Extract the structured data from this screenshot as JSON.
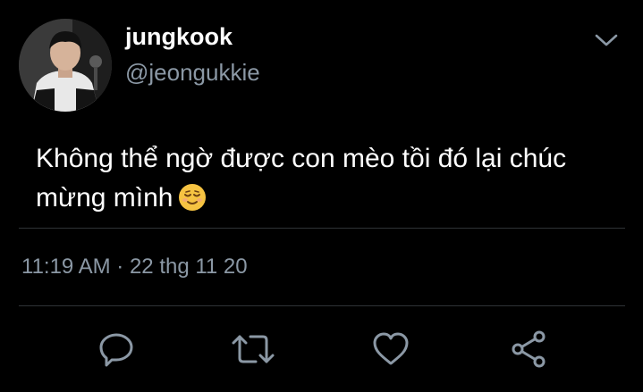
{
  "author": {
    "display_name": "jungkook",
    "handle": "@jeongukkie"
  },
  "tweet": {
    "line1": "Không thể ngờ được con mèo tồi đó lại chúc",
    "line2": "mừng mình",
    "emoji": "relieved-face-emoji",
    "timestamp": "11:19 AM · 22 thg 11 20"
  },
  "icons": {
    "menu": "chevron-down-icon",
    "reply": "reply-icon",
    "retweet": "retweet-icon",
    "like": "heart-icon",
    "share": "share-icon"
  },
  "colors": {
    "background": "#000000",
    "text": "#ffffff",
    "secondary_text": "#8b98a5",
    "divider": "#2f3336",
    "emoji": "#f6c342"
  }
}
